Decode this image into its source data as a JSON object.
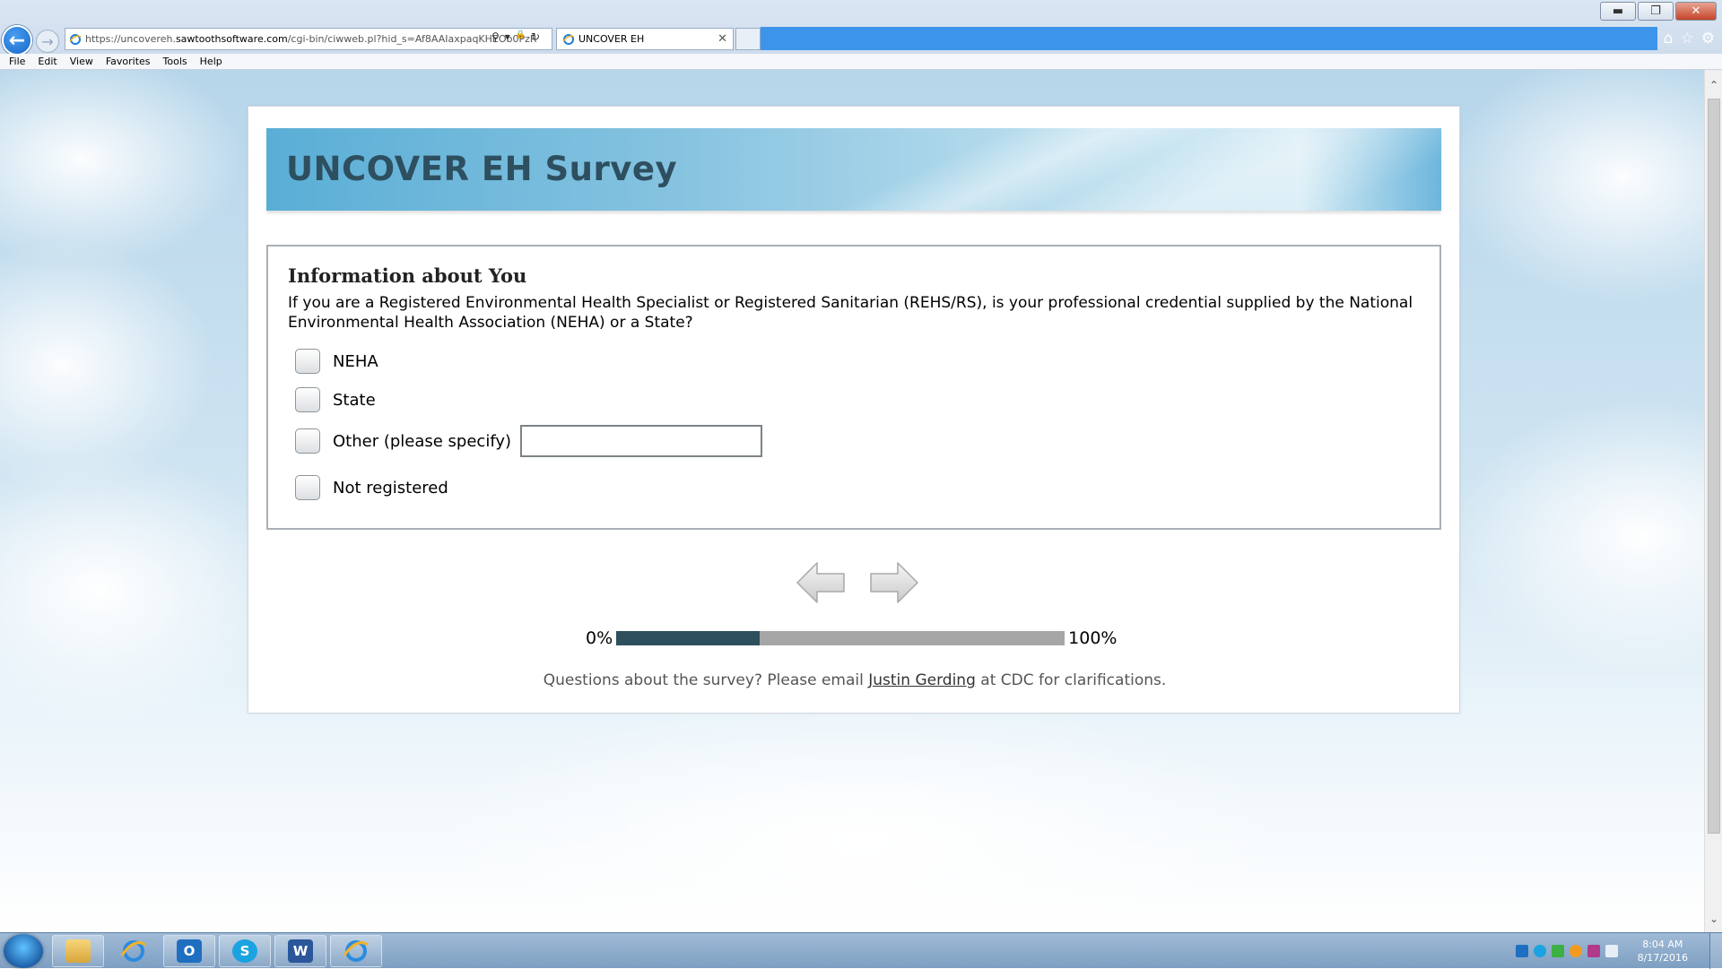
{
  "browser": {
    "url_prefix": "https://uncovereh.",
    "url_domain": "sawtoothsoftware.com",
    "url_rest": "/cgi-bin/ciwweb.pl?hid_s=Af8AAIaxpaqKHEOb0PzR",
    "tab_title": "UNCOVER EH",
    "win_minimize": "▬",
    "win_restore": "❐",
    "win_close": "✕",
    "tab_close": "✕",
    "back": "←",
    "forward": "→",
    "addr_search": "⚲",
    "addr_dropdown": "▾",
    "addr_lock": "🔒",
    "addr_refresh": "↻",
    "home": "⌂",
    "favorites": "☆",
    "tools": "⚙",
    "menu": [
      "File",
      "Edit",
      "View",
      "Favorites",
      "Tools",
      "Help"
    ],
    "scroll_up": "⌃",
    "scroll_down": "⌄"
  },
  "survey": {
    "title": "UNCOVER EH Survey",
    "section_heading": "Information about You",
    "question": "If you are a Registered Environmental Health Specialist or Registered Sanitarian (REHS/RS), is your professional credential supplied by the National Environmental Health Association (NEHA) or a State?",
    "options": [
      "NEHA",
      "State",
      "Other (please specify)",
      "Not registered"
    ],
    "other_value": "",
    "progress": {
      "start_label": "0%",
      "end_label": "100%",
      "fraction": 0.32
    },
    "footer": {
      "before": "Questions about the survey? Please email ",
      "link": "Justin Gerding",
      "after": " at CDC for clarifications."
    }
  },
  "taskbar": {
    "outlook_label": "O",
    "word_label": "W",
    "skype_label": "S",
    "ie_label": "e",
    "time": "8:04 AM",
    "date": "8/17/2016"
  },
  "colors": {
    "accent_blue": "#3d95ea",
    "title_text": "#2d4f5f",
    "progress_fill": "#2e4f5c",
    "progress_track": "#a6a6a6"
  }
}
